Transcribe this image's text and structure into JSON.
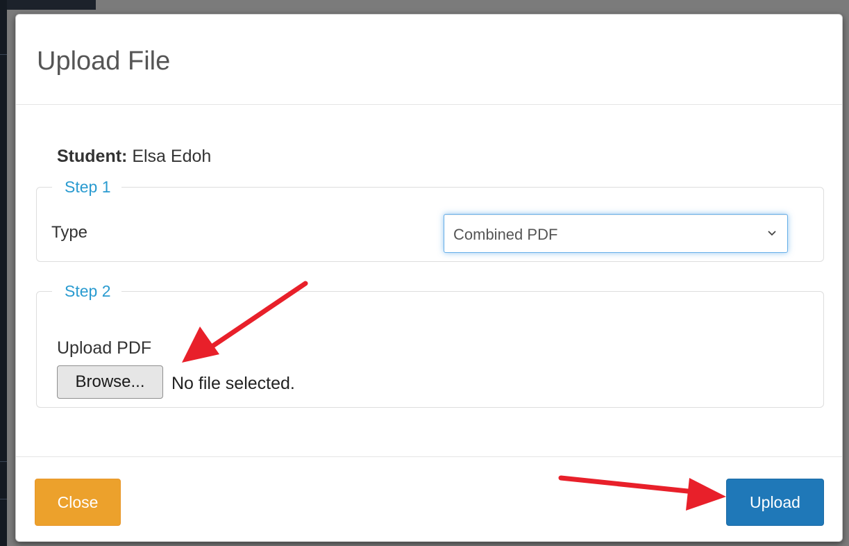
{
  "modal": {
    "title": "Upload File"
  },
  "student": {
    "label": "Student:",
    "name": "Elsa Edoh"
  },
  "step1": {
    "legend": "Step 1",
    "type_label": "Type",
    "type_selected": "Combined PDF"
  },
  "step2": {
    "legend": "Step 2",
    "upload_label": "Upload PDF",
    "browse_label": "Browse...",
    "file_status": "No file selected."
  },
  "footer": {
    "close_label": "Close",
    "upload_label": "Upload"
  },
  "colors": {
    "close_button": "#eca12c",
    "upload_button": "#1f78b8",
    "legend_text": "#2a9bd0",
    "annotation_arrow": "#e8202a"
  },
  "icons": {
    "select_chevron": "chevron-down-icon"
  }
}
